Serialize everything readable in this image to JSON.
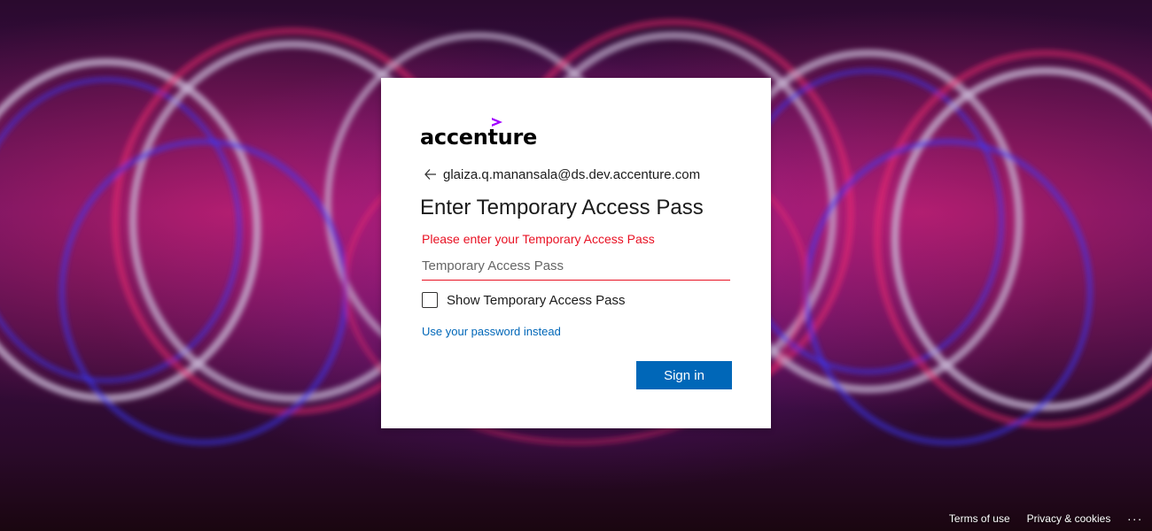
{
  "brand": {
    "name": "accenture",
    "mark_icon": "chevron-right-icon",
    "mark_color": "#a100ff"
  },
  "identity": {
    "back_icon": "arrow-left-icon",
    "email": "glaiza.q.manansala@ds.dev.accenture.com"
  },
  "form": {
    "title": "Enter Temporary Access Pass",
    "error_text": "Please enter your Temporary Access Pass",
    "input_placeholder": "Temporary Access Pass",
    "input_value": "",
    "show_checkbox_label": "Show Temporary Access Pass",
    "show_checkbox_checked": false,
    "alt_link_text": "Use your password instead",
    "submit_label": "Sign in"
  },
  "footer": {
    "terms_label": "Terms of use",
    "privacy_label": "Privacy & cookies",
    "more_label": "..."
  },
  "colors": {
    "accent": "#0067b8",
    "error": "#e81123",
    "brand_purple": "#a100ff"
  }
}
